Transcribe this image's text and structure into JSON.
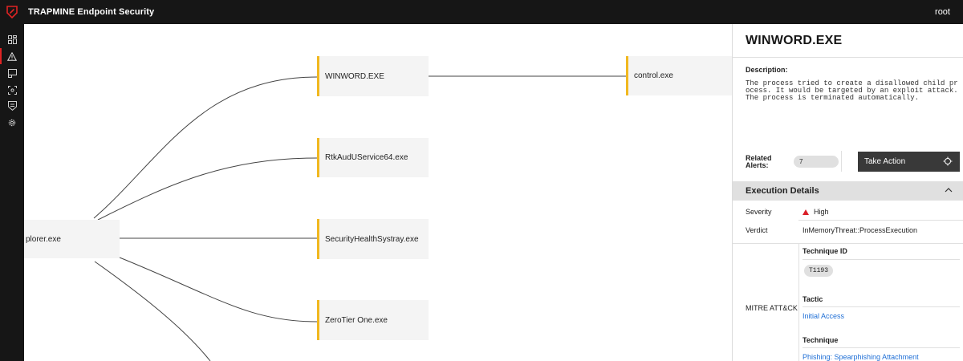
{
  "app": {
    "title": "TRAPMINE Endpoint Security",
    "user": "root"
  },
  "sidebar": {
    "items": [
      {
        "icon": "dashboard-icon"
      },
      {
        "icon": "alert-triangle-icon",
        "active": true
      },
      {
        "icon": "report-icon"
      },
      {
        "icon": "scan-icon"
      },
      {
        "icon": "shield-icon"
      },
      {
        "icon": "gear-icon"
      }
    ]
  },
  "graph": {
    "root": {
      "label": "plorer.exe"
    },
    "children": [
      {
        "label": "WINWORD.EXE"
      },
      {
        "label": "RtkAudUService64.exe"
      },
      {
        "label": "SecurityHealthSystray.exe"
      },
      {
        "label": "ZeroTier One.exe"
      }
    ],
    "grandchild": {
      "label": "control.exe"
    }
  },
  "panel": {
    "title": "WINWORD.EXE",
    "description_label": "Description:",
    "description": "The process tried to create a disallowed child process. It would be targeted by an exploit attack. The process is terminated automatically.",
    "related_alerts_label": "Related Alerts:",
    "related_alerts_count": "7",
    "take_action_label": "Take Action",
    "execution_details_label": "Execution Details",
    "severity_label": "Severity",
    "severity_value": "High",
    "verdict_label": "Verdict",
    "verdict_value": "InMemoryThreat::ProcessExecution",
    "mitre_label": "MITRE ATT&CK",
    "technique_id_label": "Technique ID",
    "technique_id_value": "T1193",
    "tactic_label": "Tactic",
    "tactic_value": "Initial Access",
    "technique_label": "Technique",
    "technique_value": "Phishing: Spearphishing Attachment"
  },
  "colors": {
    "accent": "#f1b81f",
    "severity_high": "#da1e28",
    "link": "#1f6fd6",
    "topbar": "#161616"
  }
}
